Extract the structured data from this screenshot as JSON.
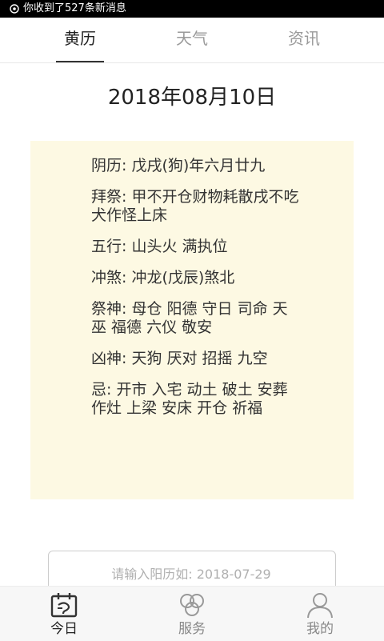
{
  "status_bar": {
    "notification_text": "你收到了527条新消息",
    "icon": "notification-app-icon"
  },
  "tabs": [
    {
      "label": "黄历",
      "active": true
    },
    {
      "label": "天气",
      "active": false
    },
    {
      "label": "资讯",
      "active": false
    }
  ],
  "date_title": "2018年08月10日",
  "almanac": {
    "items": [
      {
        "label": "阴历",
        "value": "戊戌(狗)年六月廿九"
      },
      {
        "label": "拜祭",
        "value": "甲不开仓财物耗散戌不吃犬作怪上床"
      },
      {
        "label": "五行",
        "value": "山头火 满执位"
      },
      {
        "label": "冲煞",
        "value": "冲龙(戊辰)煞北"
      },
      {
        "label": "祭神",
        "value": "母仓 阳德 守日 司命 天巫 福德 六仪 敬安"
      },
      {
        "label": "凶神",
        "value": "天狗 厌对 招摇 九空"
      },
      {
        "label": "忌",
        "value": "开市 入宅 动土 破土 安葬 作灶 上梁 安床 开仓 祈福"
      }
    ],
    "separator": ": ",
    "background_color": "#fdf9e3"
  },
  "date_input": {
    "value": "",
    "placeholder": "请输入阳历如: 2018-07-29"
  },
  "bottom_nav": {
    "items": [
      {
        "label": "今日",
        "icon": "calendar-icon",
        "active": true
      },
      {
        "label": "服务",
        "icon": "circles-icon",
        "active": false
      },
      {
        "label": "我的",
        "icon": "user-icon",
        "active": false
      }
    ]
  }
}
